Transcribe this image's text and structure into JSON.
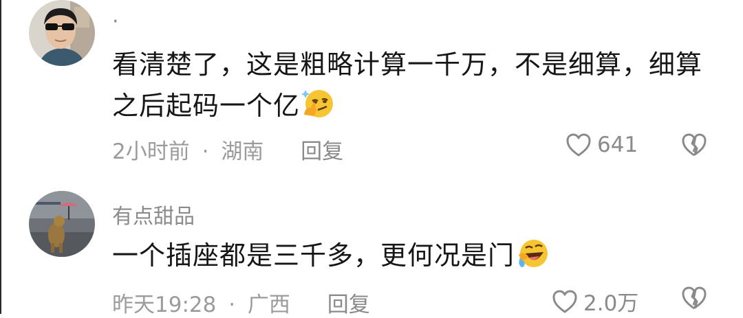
{
  "comments": [
    {
      "username": "·",
      "text_line1": "看清楚了，这是粗略计算一千万，不是细算，细算",
      "text_line2": "之后起码一个亿",
      "emoji": "smirk-hand-icon",
      "time": "2小时前",
      "separator": "·",
      "location": "湖南",
      "reply_label": "回复",
      "likes": "641"
    },
    {
      "username": "有点甜品",
      "text_line1": "一个插座都是三千多，更何况是门",
      "emoji": "laugh-cry-icon",
      "time": "昨天19:28",
      "separator": "·",
      "location": "广西",
      "reply_label": "回复",
      "likes": "2.0万"
    }
  ],
  "colors": {
    "text": "#161616",
    "meta": "#9b9b9b",
    "emoji_yellow": "#f7c531"
  }
}
